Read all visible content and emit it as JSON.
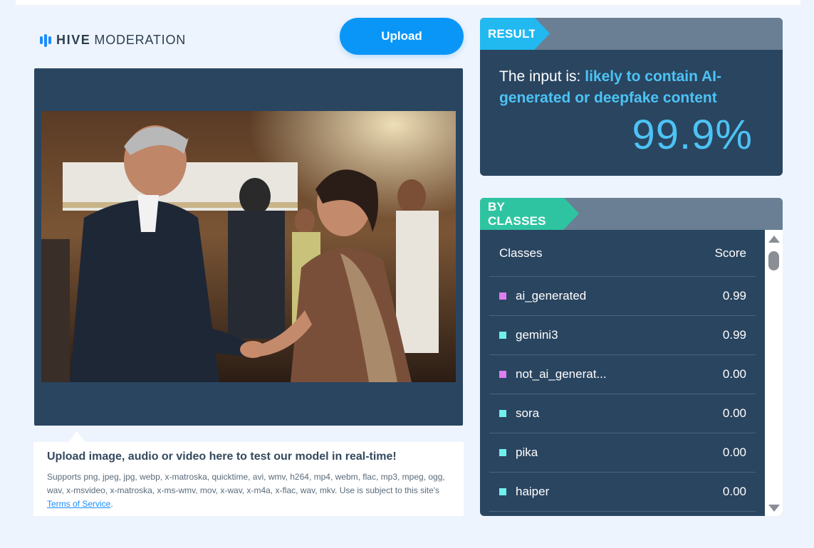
{
  "logo": {
    "brand": "HIVE",
    "product": "MODERATION",
    "icon": "hive-bars-icon",
    "brand_color": "#1a8cff"
  },
  "upload_button": {
    "label": "Upload"
  },
  "media": {
    "image_subject": "photo-of-two-people-shaking-hands-at-conference",
    "upload_caret": "caret-up-icon"
  },
  "info": {
    "title": "Upload image, audio or video here to test our model in real-time!",
    "supports_text": "Supports png, jpeg, jpg, webp, x-matroska, quicktime, avi, wmv, h264, mp4, webm, flac, mp3, mpeg, ogg, wav, x-msvideo, x-matroska, x-ms-wmv, mov, x-wav, x-m4a, x-flac, wav, mkv. Use is subject to this site's ",
    "terms_link": "Terms of Service",
    "after_link": "."
  },
  "result": {
    "tag": "RESULT",
    "prefix": "The input is: ",
    "verdict": "likely to contain AI-generated or deepfake content",
    "score": "99.9%",
    "accent": "#22b8f0"
  },
  "classes": {
    "tag": "BY CLASSES",
    "accent": "#2fc4a1",
    "col_classes": "Classes",
    "col_score": "Score",
    "rows": [
      {
        "name": "ai_generated",
        "score": "0.99",
        "color": "#e07df0"
      },
      {
        "name": "gemini3",
        "score": "0.99",
        "color": "#6ff0ec"
      },
      {
        "name": "not_ai_generat...",
        "score": "0.00",
        "color": "#e07df0"
      },
      {
        "name": "sora",
        "score": "0.00",
        "color": "#6ff0ec"
      },
      {
        "name": "pika",
        "score": "0.00",
        "color": "#6ff0ec"
      },
      {
        "name": "haiper",
        "score": "0.00",
        "color": "#6ff0ec"
      }
    ]
  }
}
